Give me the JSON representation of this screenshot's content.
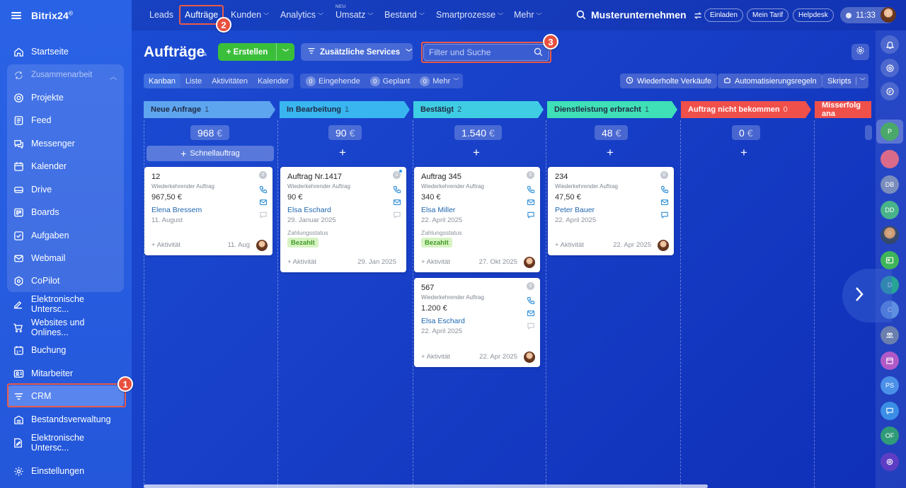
{
  "app": {
    "brand": "Bitrix24",
    "brand_mark": "©",
    "company": "Musterunternehmen",
    "time": "11:33"
  },
  "colors": {
    "accent_green": "#3bbf3b",
    "annotation_red": "#e85b4a",
    "paid_bg": "#d7f3c4",
    "paid_text": "#3f9a24"
  },
  "sidebar": {
    "items": [
      {
        "label": "Startseite",
        "icon": "home-icon"
      },
      {
        "label": "Zusammenarbeit",
        "icon": "collaboration-icon"
      },
      {
        "label": "Projekte",
        "icon": "projects-icon"
      },
      {
        "label": "Feed",
        "icon": "feed-icon"
      },
      {
        "label": "Messenger",
        "icon": "messenger-icon"
      },
      {
        "label": "Kalender",
        "icon": "calendar-icon"
      },
      {
        "label": "Drive",
        "icon": "drive-icon"
      },
      {
        "label": "Boards",
        "icon": "boards-icon"
      },
      {
        "label": "Aufgaben",
        "icon": "tasks-icon"
      },
      {
        "label": "Webmail",
        "icon": "mail-icon"
      },
      {
        "label": "CoPilot",
        "icon": "copilot-icon"
      },
      {
        "label": "Elektronische Untersc...",
        "icon": "signature-icon"
      },
      {
        "label": "Websites und Onlines...",
        "icon": "cart-icon"
      },
      {
        "label": "Buchung",
        "icon": "booking-icon"
      },
      {
        "label": "Mitarbeiter",
        "icon": "employees-icon"
      },
      {
        "label": "CRM",
        "icon": "crm-funnel-icon"
      },
      {
        "label": "Bestandsverwaltung",
        "icon": "inventory-icon"
      },
      {
        "label": "Elektronische Untersc...",
        "icon": "document-sign-icon"
      },
      {
        "label": "Einstellungen",
        "icon": "gear-icon"
      }
    ]
  },
  "topnav": {
    "items": [
      {
        "label": "Leads",
        "caret": false
      },
      {
        "label": "Aufträge",
        "caret": false
      },
      {
        "label": "Kunden",
        "caret": true
      },
      {
        "label": "Analytics",
        "caret": true
      },
      {
        "label": "Umsatz",
        "caret": true,
        "tag": "NEU"
      },
      {
        "label": "Bestand",
        "caret": true
      },
      {
        "label": "Smartprozesse",
        "caret": true
      },
      {
        "label": "Mehr",
        "caret": true
      }
    ],
    "pills": [
      "Einladen",
      "Mein Tarif",
      "Helpdesk"
    ]
  },
  "annotations": [
    "1",
    "2",
    "3"
  ],
  "page": {
    "title": "Aufträge",
    "create_label": "Erstellen",
    "services_label": "Zusätzliche Services",
    "search_placeholder": "Filter und Suche"
  },
  "views": [
    "Kanban",
    "Liste",
    "Aktivitäten",
    "Kalender"
  ],
  "counters": [
    {
      "count": "0",
      "label": "Eingehende"
    },
    {
      "count": "0",
      "label": "Geplant"
    },
    {
      "count": "0",
      "label": "Mehr"
    }
  ],
  "right_buttons": [
    "Wiederholte Verkäufe",
    "Automatisierungsregeln",
    "Skripts"
  ],
  "quick_add_label": "Schnellauftrag",
  "currency": "€",
  "columns": [
    {
      "name": "Neue Anfrage",
      "count": "1",
      "sum": "968",
      "color": "#5ea5f0"
    },
    {
      "name": "In Bearbeitung",
      "count": "1",
      "sum": "90",
      "color": "#39b6f0"
    },
    {
      "name": "Bestätigt",
      "count": "2",
      "sum": "1.540",
      "color": "#3fcde4"
    },
    {
      "name": "Dienstleistung erbracht",
      "count": "1",
      "sum": "48",
      "color": "#3fe0b8"
    },
    {
      "name": "Auftrag nicht bekommen",
      "count": "0",
      "sum": "0",
      "color": "#f0504a"
    },
    {
      "name": "Misserfolg ana",
      "count": "",
      "sum": "",
      "color": "#f0504a"
    }
  ],
  "cards": [
    {
      "title": "12",
      "sub": "Wiederkehrender Auftrag",
      "sum": "967,50 €",
      "contact": "Elena Bressem",
      "date": "11. August",
      "status_label": "",
      "status": "",
      "activity": "+ Aktivität",
      "last": "11. Aug"
    },
    {
      "title": "Auftrag Nr.1417",
      "sub": "Wiederkehrender Auftrag",
      "sum": "90 €",
      "contact": "Elsa Eschard",
      "date": "29. Januar 2025",
      "status_label": "Zahlungsstatus",
      "status": "Bezahlt",
      "activity": "+ Aktivität",
      "last": "29. Jan 2025"
    },
    {
      "title": "Auftrag 345",
      "sub": "Wiederkehrender Auftrag",
      "sum": "340 €",
      "contact": "Elsa Miller",
      "date": "22. April 2025",
      "status_label": "Zahlungsstatus",
      "status": "Bezahlt",
      "activity": "+ Aktivität",
      "last": "27. Okt 2025"
    },
    {
      "title": "567",
      "sub": "Wiederkehrender Auftrag",
      "sum": "1.200 €",
      "contact": "Elsa Eschard",
      "date": "22. April 2025",
      "status_label": "",
      "status": "",
      "activity": "+ Aktivität",
      "last": "22. Apr 2025"
    },
    {
      "title": "234",
      "sub": "Wiederkehrender Auftrag",
      "sum": "47,50 €",
      "contact": "Peter Bauer",
      "date": "22. April 2025",
      "status_label": "",
      "status": "",
      "activity": "+ Aktivität",
      "last": "22. Apr 2025"
    }
  ],
  "card_counter": "0",
  "rail": {
    "initials": [
      "P",
      "DB",
      "DD",
      "D",
      "C",
      "PS",
      "OF"
    ]
  }
}
